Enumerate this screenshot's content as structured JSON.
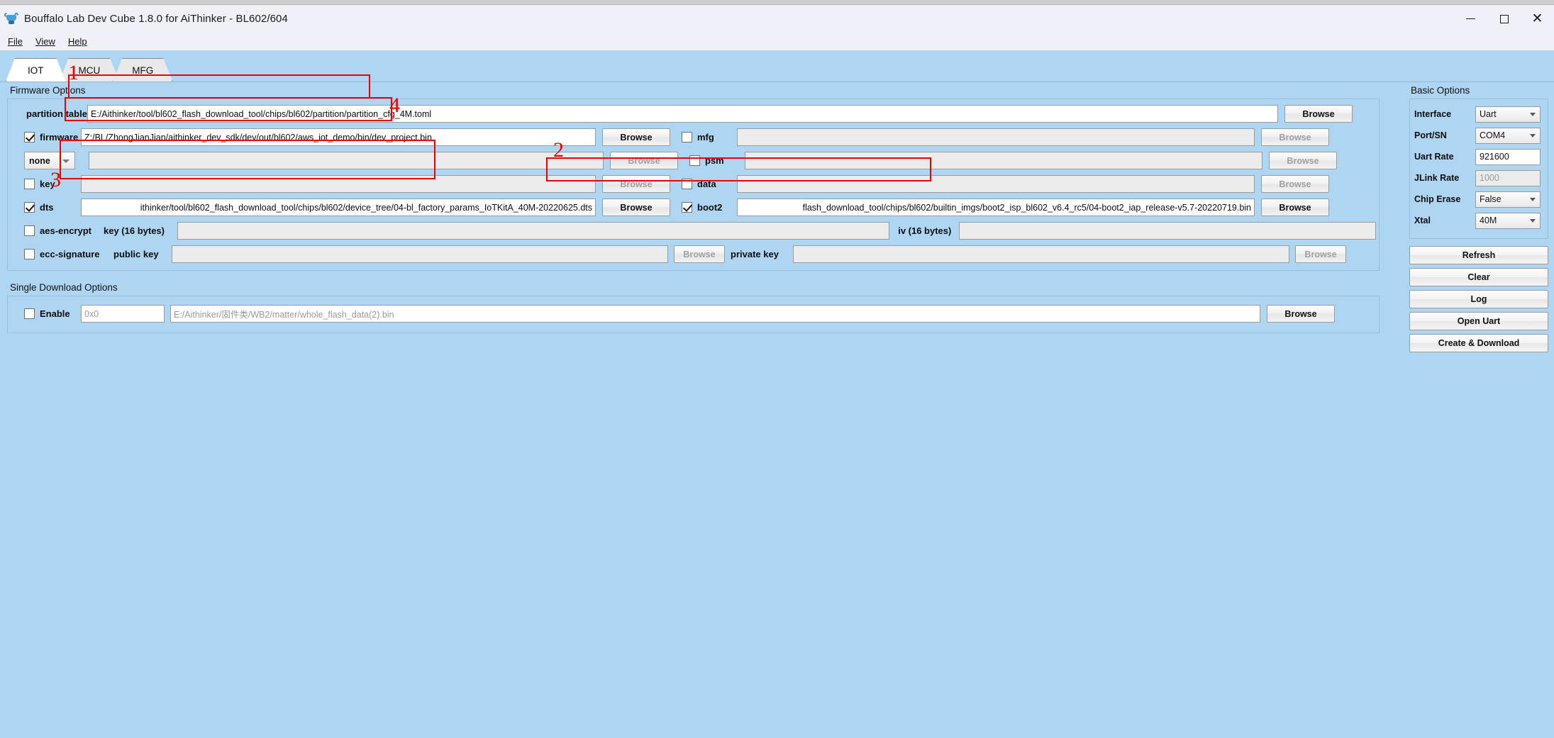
{
  "window": {
    "title": "Bouffalo Lab Dev Cube 1.8.0 for AiThinker - BL602/604",
    "minimize_label": "",
    "maximize_label": "",
    "close_label": "✕"
  },
  "menu": [
    {
      "label": "File"
    },
    {
      "label": "View"
    },
    {
      "label": "Help"
    }
  ],
  "tabs": [
    {
      "label": "IOT",
      "active": true
    },
    {
      "label": "MCU",
      "active": false
    },
    {
      "label": "MFG",
      "active": false
    }
  ],
  "firmware_options": {
    "title": "Firmware Options",
    "partition_table": {
      "label": "partition table",
      "value": "E:/Aithinker/tool/bl602_flash_download_tool/chips/bl602/partition/partition_cfg_4M.toml",
      "browse_label": "Browse"
    },
    "firmware": {
      "label": "firmware",
      "checked": true,
      "value": "Z:/BL/ZhongJianJian/aithinker_dev_sdk/dev/out/bl602/aws_iot_demo/bin/dev_project.bin",
      "browse_label": "Browse"
    },
    "none_row": {
      "combo_value": "none",
      "value": "",
      "browse_label": "Browse"
    },
    "key": {
      "label": "key",
      "checked": false,
      "value": "",
      "browse_label": "Browse"
    },
    "dts": {
      "label": "dts",
      "checked": true,
      "value": "ithinker/tool/bl602_flash_download_tool/chips/bl602/device_tree/04-bl_factory_params_IoTKitA_40M-20220625.dts",
      "browse_label": "Browse"
    },
    "mfg": {
      "label": "mfg",
      "checked": false,
      "value": "",
      "browse_label": "Browse"
    },
    "psm": {
      "label": "psm",
      "checked": false,
      "value": "",
      "browse_label": "Browse"
    },
    "data": {
      "label": "data",
      "checked": false,
      "value": "",
      "browse_label": "Browse"
    },
    "boot2": {
      "label": "boot2",
      "checked": true,
      "value": "flash_download_tool/chips/bl602/builtin_imgs/boot2_isp_bl602_v6.4_rc5/04-boot2_iap_release-v5.7-20220719.bin",
      "browse_label": "Browse"
    },
    "aes_encrypt": {
      "label": "aes-encrypt",
      "checked": false,
      "key_label": "key (16 bytes)",
      "key_value": "",
      "iv_label": "iv (16 bytes)",
      "iv_value": ""
    },
    "ecc_signature": {
      "label": "ecc-signature",
      "checked": false,
      "public_key_label": "public key",
      "public_key_value": "",
      "browse_label": "Browse",
      "private_key_label": "private key",
      "private_key_value": "",
      "private_browse_label": "Browse"
    }
  },
  "single_download_options": {
    "title": "Single Download Options",
    "enable_label": "Enable",
    "enable_checked": false,
    "address_placeholder": "0x0",
    "file_placeholder": "E:/Aithinker/固件类/WB2/matter/whole_flash_data(2).bin",
    "browse_label": "Browse"
  },
  "basic_options": {
    "title": "Basic Options",
    "rows": [
      {
        "label": "Interface",
        "value": "Uart",
        "kind": "combo"
      },
      {
        "label": "Port/SN",
        "value": "COM4",
        "kind": "combo"
      },
      {
        "label": "Uart Rate",
        "value": "921600",
        "kind": "input"
      },
      {
        "label": "JLink Rate",
        "value": "1000",
        "kind": "input-disabled"
      },
      {
        "label": "Chip Erase",
        "value": "False",
        "kind": "combo"
      },
      {
        "label": "Xtal",
        "value": "40M",
        "kind": "combo"
      }
    ],
    "buttons": [
      {
        "label": "Refresh"
      },
      {
        "label": "Clear"
      },
      {
        "label": "Log"
      },
      {
        "label": "Open Uart"
      },
      {
        "label": "Create & Download"
      }
    ]
  },
  "annotations": [
    {
      "number": "1"
    },
    {
      "number": "2"
    },
    {
      "number": "3"
    },
    {
      "number": "4"
    }
  ],
  "colors": {
    "background": "#aed5f2",
    "annotation": "#ee0000",
    "titlebar": "#eef1f7"
  }
}
